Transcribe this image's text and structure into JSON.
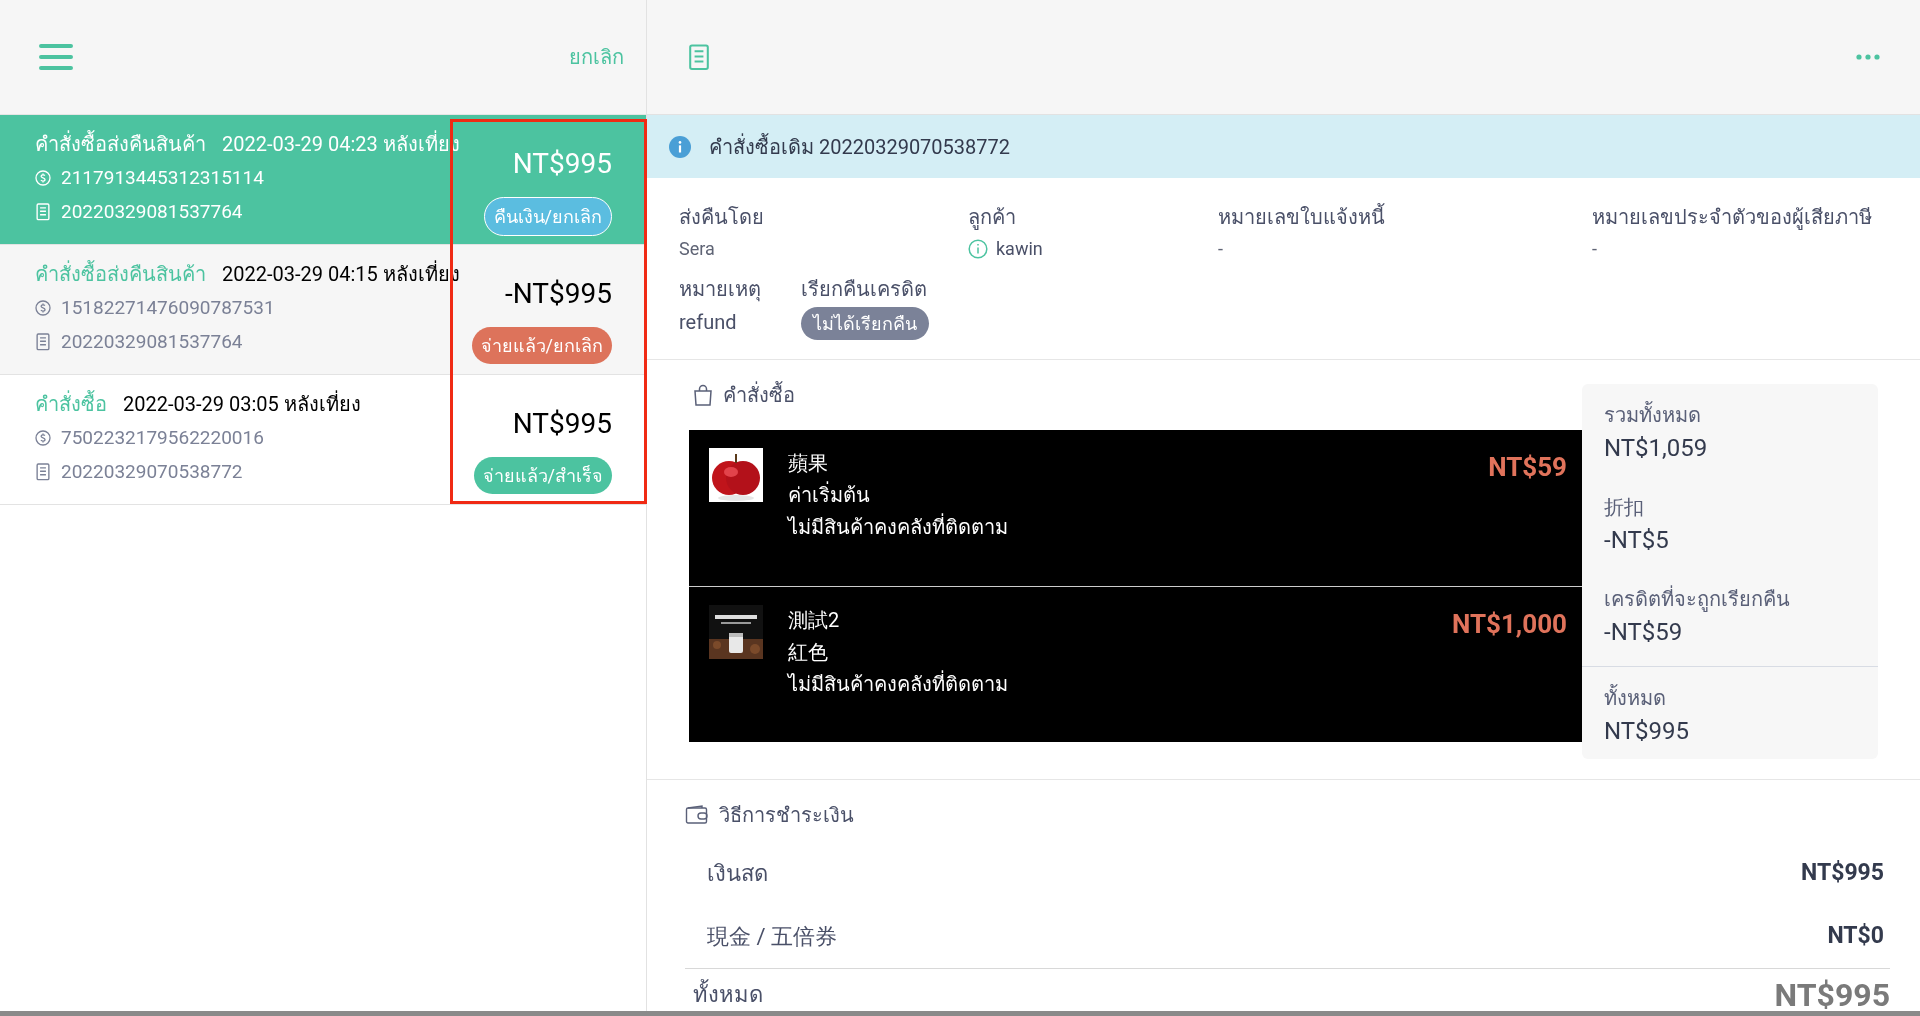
{
  "list_header": {
    "cancel": "ยกเลิก"
  },
  "orders": [
    {
      "type": "คำสั่งซื้อส่งคืนสินค้า",
      "datetime": "2022-03-29 04:23 หลังเที่ยง",
      "payment_id": "2117913445312315114",
      "order_no": "20220329081537764",
      "amount": "NT$995",
      "status": "คืนเงิน/ยกเลิก",
      "color": "#5bbde0",
      "selected": true
    },
    {
      "type": "คำสั่งซื้อส่งคืนสินค้า",
      "datetime": "2022-03-29 04:15 หลังเที่ยง",
      "payment_id": "15182271476090787531",
      "order_no": "20220329081537764",
      "amount": "-NT$995",
      "status": "จ่ายแล้ว/ยกเลิก",
      "color": "#dd735b",
      "selected": false
    },
    {
      "type": "คำสั่งซื้อ",
      "datetime": "2022-03-29 03:05 หลังเที่ยง",
      "payment_id": "7502232179562220016",
      "order_no": "20220329070538772",
      "amount": "NT$995",
      "status": "จ่ายแล้ว/สำเร็จ",
      "color": "#4cc3a0",
      "selected": false
    }
  ],
  "banner": {
    "text": "คำสั่งซื้อเดิม 20220329070538772"
  },
  "details": [
    [
      {
        "label": "ส่งคืนโดย",
        "value": "Sera",
        "kind": "text"
      },
      {
        "label": "ลูกค้า",
        "value": "kawin",
        "kind": "customer"
      },
      {
        "label": "หมายเลขใบแจ้งหนี้",
        "value": "-",
        "kind": "text"
      },
      {
        "label": "หมายเลขประจำตัวของผู้เสียภาษี",
        "value": "-",
        "kind": "text"
      }
    ],
    [
      {
        "label": "หมายเหตุ",
        "value": "refund",
        "kind": "note"
      },
      {
        "label": "เรียกคืนเครดิต",
        "value": "ไม่ได้เรียกคืน",
        "kind": "badge"
      }
    ]
  ],
  "order_section": {
    "title": "คำสั่งซื้อ",
    "items": [
      {
        "name": "蘋果",
        "variant": "ค่าเริ่มต้น",
        "stock": "ไม่มีสินค้าคงคลังที่ติดตาม",
        "price": "NT$59",
        "kind": "picture"
      },
      {
        "name": "測試2",
        "variant": "紅色",
        "stock": "ไม่มีสินค้าคงคลังที่ติดตาม",
        "price": "NT$1,000",
        "kind": "picture"
      }
    ],
    "summary": [
      {
        "label": "รวมทั้งหมด",
        "value": "NT$1,059",
        "kind": "line"
      },
      {
        "label": "折扣",
        "value": "-NT$5",
        "kind": "line"
      },
      {
        "label": "เครดิตที่จะถูกเรียกคืน",
        "value": "-NT$59",
        "kind": "line"
      },
      {
        "label": "ทั้งหมด",
        "value": "NT$995",
        "kind": "total"
      }
    ]
  },
  "payment": {
    "title": "วิธีการชำระเงิน",
    "methods": [
      {
        "label": "เงินสด",
        "amount": "NT$995"
      },
      {
        "label": "現金 / 五倍券",
        "amount": "NT$0"
      }
    ],
    "total": {
      "label": "ทั้งหมด",
      "amount": "NT$995"
    }
  }
}
